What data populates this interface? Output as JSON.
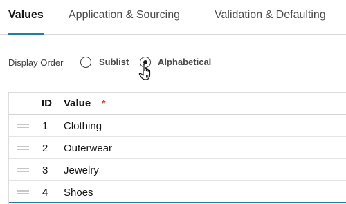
{
  "tabs": [
    {
      "label": "Values",
      "mnemonic": "V",
      "rest": "alues",
      "active": true
    },
    {
      "label": "Application & Sourcing",
      "mnemonic": "A",
      "rest": "pplication & Sourcing",
      "active": false
    },
    {
      "label": "Validation & Defaulting",
      "pre": "Va",
      "mnemonic": "l",
      "rest": "idation & Defaulting",
      "active": false
    }
  ],
  "display_order": {
    "label": "Display Order",
    "options": [
      {
        "label": "Sublist",
        "checked": false
      },
      {
        "label": "Alphabetical",
        "checked": true
      }
    ]
  },
  "table": {
    "columns": {
      "id": "ID",
      "value": "Value",
      "required_marker": "*"
    },
    "rows": [
      {
        "id": "1",
        "value": "Clothing"
      },
      {
        "id": "2",
        "value": "Outerwear"
      },
      {
        "id": "3",
        "value": "Jewelry"
      },
      {
        "id": "4",
        "value": "Shoes"
      }
    ]
  },
  "colors": {
    "accent": "#227e9e",
    "required": "#c74634"
  },
  "icons": {
    "cursor": "hand-pointer-icon",
    "drag_handle": "drag-handle-icon"
  }
}
